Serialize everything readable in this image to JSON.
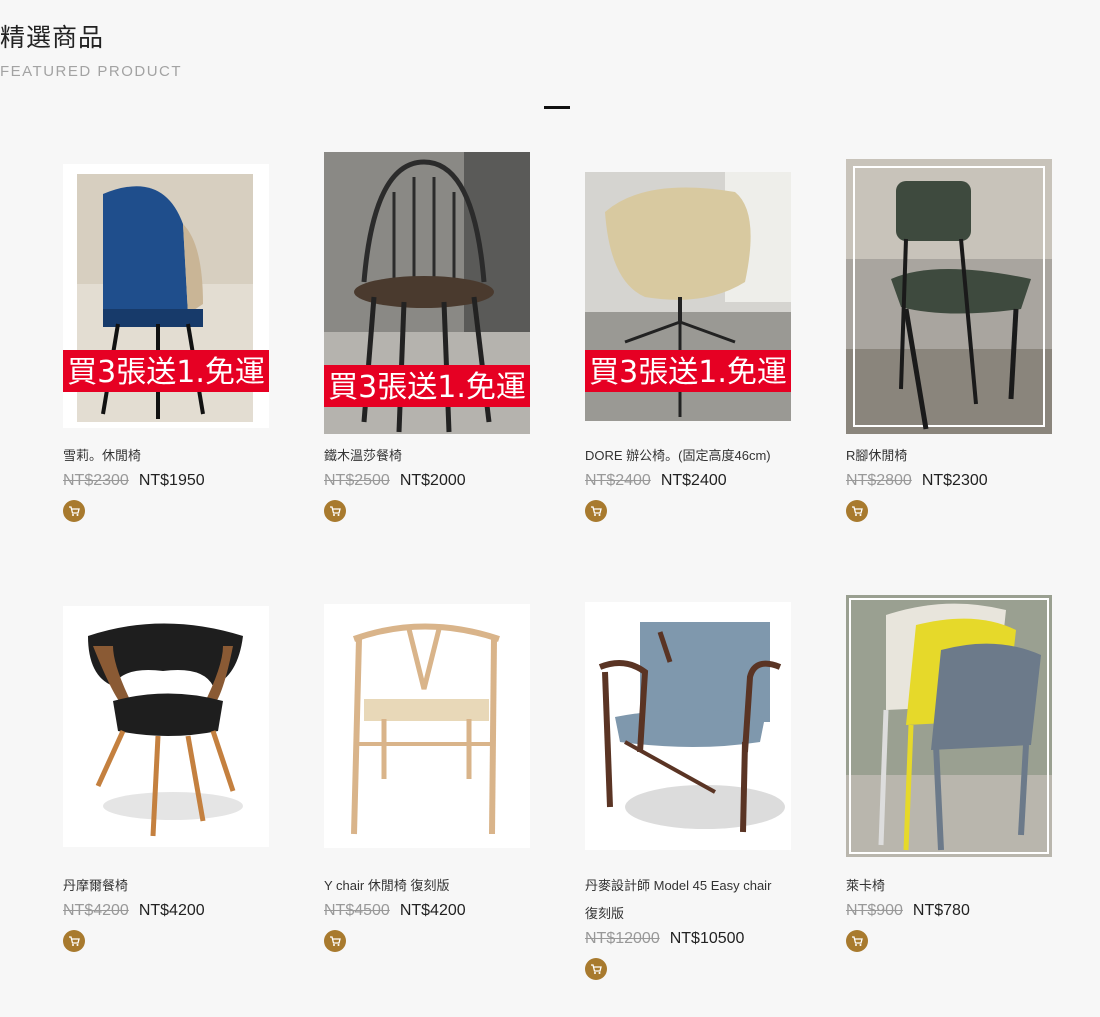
{
  "section": {
    "title": "精選商品",
    "subtitle": "FEATURED PRODUCT"
  },
  "badge_text": "買3張送1.免運",
  "products": [
    {
      "name": "雪莉。休閒椅",
      "old_price": "NT$2300",
      "price": "NT$1950",
      "badge": true,
      "chair_color": "#1f4e8c"
    },
    {
      "name": "鐵木溫莎餐椅",
      "old_price": "NT$2500",
      "price": "NT$2000",
      "badge": true,
      "chair_color": "#2b2b2b"
    },
    {
      "name": "DORE 辦公椅。(固定高度46cm)",
      "old_price": "NT$2400",
      "price": "NT$2400",
      "badge": true,
      "chair_color": "#d8c9a0"
    },
    {
      "name": "R腳休閒椅",
      "old_price": "NT$2800",
      "price": "NT$2300",
      "badge": false,
      "chair_color": "#3e4a3e"
    },
    {
      "name": "丹摩爾餐椅",
      "old_price": "NT$4200",
      "price": "NT$4200",
      "badge": false,
      "chair_color": "#1e1e1e"
    },
    {
      "name": "Y chair 休閒椅 復刻版",
      "old_price": "NT$4500",
      "price": "NT$4200",
      "badge": false,
      "chair_color": "#d9b48a"
    },
    {
      "name_line1": "丹麥設計師 Model 45 Easy chair",
      "name_line2": "復刻版",
      "old_price": "NT$12000",
      "price": "NT$10500",
      "badge": false,
      "chair_color": "#7f98ad"
    },
    {
      "name": "萊卡椅",
      "old_price": "NT$900",
      "price": "NT$780",
      "badge": false,
      "chair_color": "#e6d92a"
    }
  ],
  "colors": {
    "accent": "#a87a2e",
    "badge_red": "#e60023",
    "background": "#f7f7f7"
  },
  "icons": {
    "cart": "shopping-cart-icon"
  }
}
